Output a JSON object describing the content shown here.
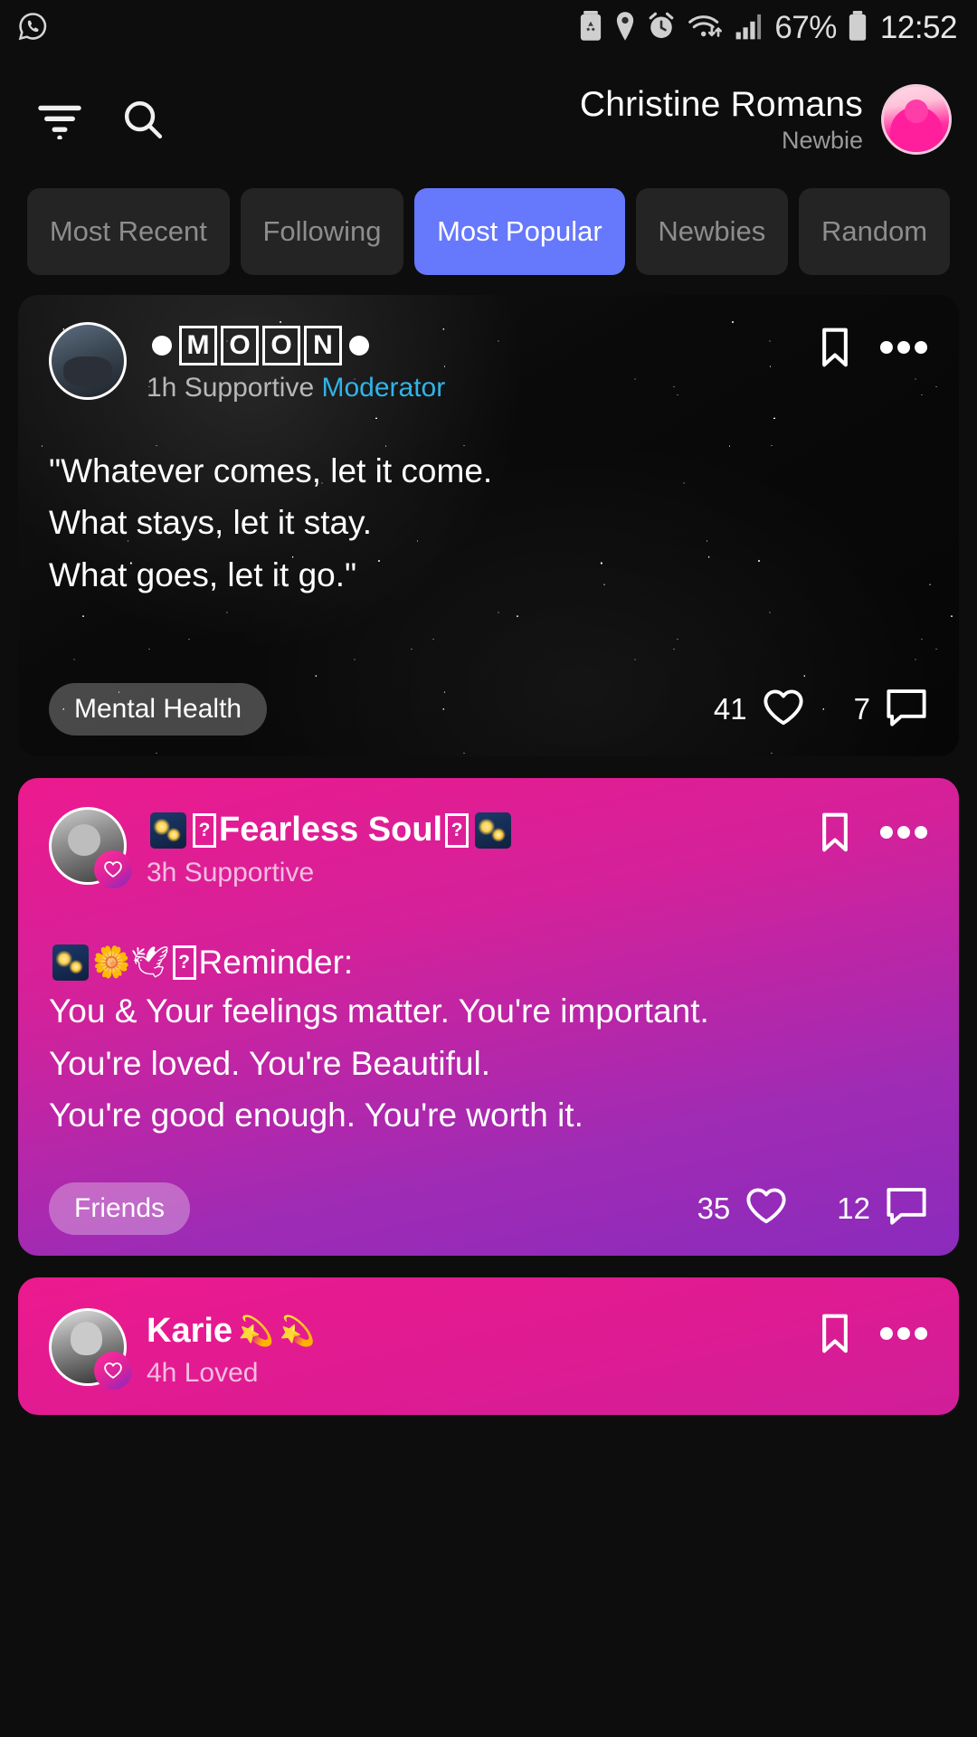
{
  "status_bar": {
    "app_icon": "whatsapp-icon",
    "icons": [
      "battery-saver-icon",
      "location-icon",
      "alarm-icon",
      "wifi-icon",
      "signal-icon"
    ],
    "battery_percent": "67%",
    "time": "12:52"
  },
  "header": {
    "filter_icon": "filter-icon",
    "search_icon": "search-icon",
    "user_name": "Christine Romans",
    "user_rank": "Newbie",
    "avatar": "user-avatar"
  },
  "tabs": [
    {
      "label": "Most Recent",
      "active": false
    },
    {
      "label": "Following",
      "active": false
    },
    {
      "label": "Most Popular",
      "active": true
    },
    {
      "label": "Newbies",
      "active": false
    },
    {
      "label": "Random",
      "active": false
    }
  ],
  "colors": {
    "active_tab": "#6678fb",
    "tab_background": "#242424",
    "moderator": "#30b4e8",
    "card_pink": "#ec1a8e",
    "card_purple": "#8a2bbd",
    "page_background": "#0d0d0d"
  },
  "posts": [
    {
      "id": "post-moon",
      "author": "●ⓂⓞⓞⓃ●",
      "author_letters": [
        "M",
        "O",
        "O",
        "N"
      ],
      "time": "1h",
      "mood": "Supportive",
      "role": "Moderator",
      "lines": [
        "\"Whatever comes, let it come.",
        "What stays, let it stay.",
        "What goes, let it go.\""
      ],
      "tag": "Mental Health",
      "likes": "41",
      "comments": "7",
      "bookmark_icon": "bookmark-icon",
      "more_icon": "more-options-icon",
      "like_icon": "heart-icon",
      "comment_icon": "comment-icon"
    },
    {
      "id": "post-fearless-soul",
      "author": "Fearless Soul",
      "time": "3h",
      "mood": "Supportive",
      "role": "",
      "lead": "Reminder:",
      "lines": [
        "You & Your feelings matter. You're important.",
        "You're loved. You're Beautiful.",
        "You're good enough. You're worth it."
      ],
      "tag": "Friends",
      "likes": "35",
      "comments": "12",
      "bookmark_icon": "bookmark-icon",
      "more_icon": "more-options-icon",
      "like_icon": "heart-icon",
      "comment_icon": "comment-icon"
    },
    {
      "id": "post-karie",
      "author": "Karie",
      "time": "4h",
      "mood": "Loved",
      "role": "",
      "bookmark_icon": "bookmark-icon",
      "more_icon": "more-options-icon"
    }
  ]
}
